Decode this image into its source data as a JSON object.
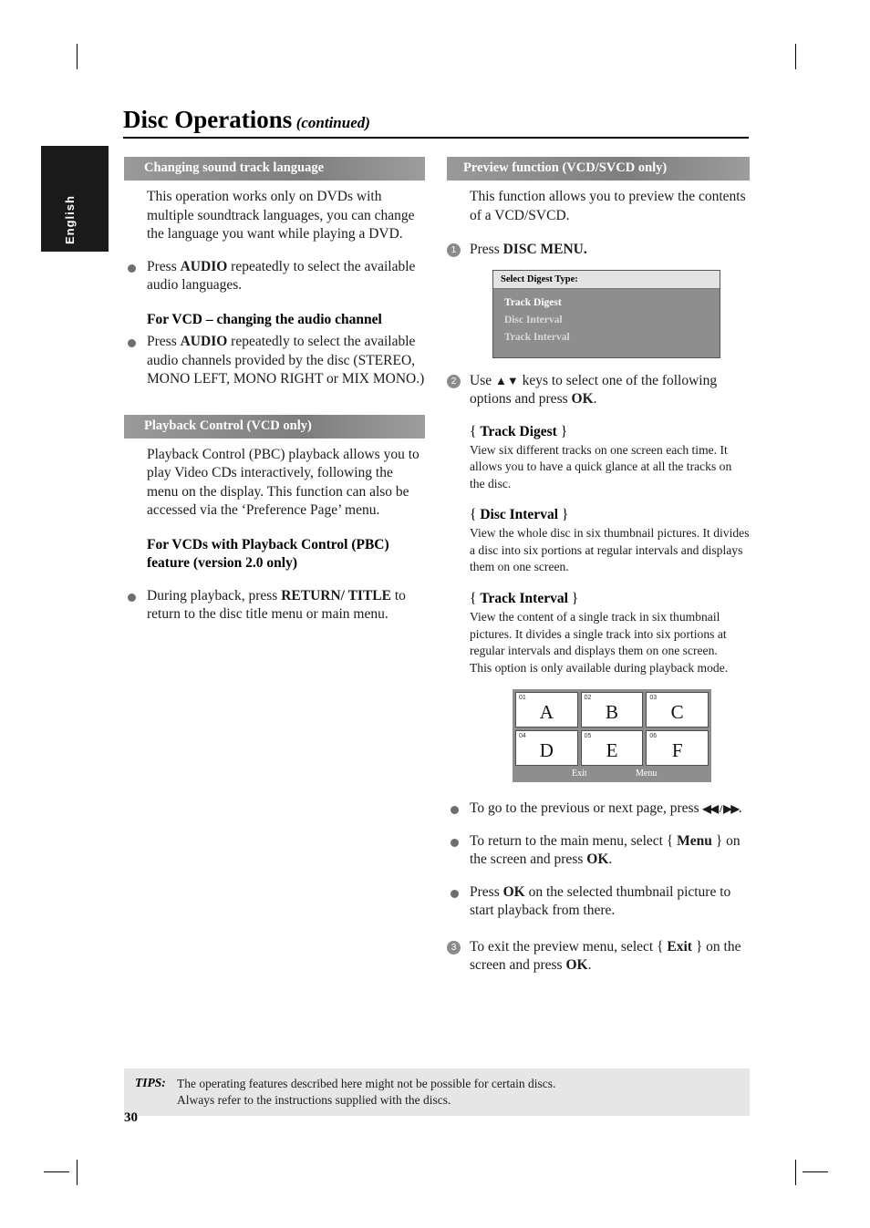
{
  "header": {
    "title": "Disc Operations",
    "title_suffix": "(continued)"
  },
  "side_tab": {
    "label": "English"
  },
  "left_column": {
    "section1": {
      "heading": "Changing sound track language",
      "intro": "This operation works only on DVDs with multiple soundtrack languages, you can change the language you want while playing a DVD.",
      "bullet1_pre": "Press ",
      "bullet1_bold": "AUDIO",
      "bullet1_post": " repeatedly to select the available audio languages.",
      "subhead": "For VCD – changing the audio channel",
      "bullet2_pre": "Press ",
      "bullet2_bold": "AUDIO",
      "bullet2_post": " repeatedly to select the available audio channels provided by the disc (STEREO, MONO LEFT, MONO RIGHT or MIX MONO.)"
    },
    "section2": {
      "heading": "Playback Control (VCD only)",
      "intro": "Playback Control (PBC) playback allows you to play Video CDs interactively, following the menu on the display.  This function can also be accessed via the ‘Preference Page’ menu.",
      "subhead": "For VCDs with Playback Control (PBC) feature (version 2.0 only)",
      "bullet1_pre": "During playback, press ",
      "bullet1_bold": "RETURN/ TITLE",
      "bullet1_post": " to return to the disc title menu or main menu."
    }
  },
  "right_column": {
    "section1": {
      "heading": "Preview function (VCD/SVCD only)",
      "intro": "This function allows you to preview the contents of a VCD/SVCD.",
      "step1_num": "1",
      "step1_pre": "Press ",
      "step1_bold": "DISC MENU.",
      "osd": {
        "title": "Select Digest Type:",
        "options": [
          "Track Digest",
          "Disc Interval",
          "Track Interval"
        ],
        "selected_index": 0
      },
      "step2_num": "2",
      "step2_pre": "Use ",
      "step2_keys": "▲▼",
      "step2_mid": " keys to select one of the following options and press ",
      "step2_bold": "OK",
      "step2_post": ".",
      "items": [
        {
          "name": "Track Digest",
          "text": "View six different tracks on one screen each time.  It allows you to have a quick glance at all the tracks on the disc."
        },
        {
          "name": "Disc Interval",
          "text": "View the whole disc in six thumbnail pictures.  It divides a disc into six portions at regular intervals and displays them on one screen."
        },
        {
          "name": "Track Interval",
          "text": "View the content of a single track in six thumbnail pictures.  It divides a single track into six portions at regular intervals and displays them on one screen.\nThis option is only available during playback mode."
        }
      ],
      "thumbnails": {
        "cells": [
          {
            "number": "01",
            "letter": "A"
          },
          {
            "number": "02",
            "letter": "B"
          },
          {
            "number": "03",
            "letter": "C"
          },
          {
            "number": "04",
            "letter": "D"
          },
          {
            "number": "05",
            "letter": "E"
          },
          {
            "number": "06",
            "letter": "F"
          }
        ],
        "exit_label": "Exit",
        "menu_label": "Menu"
      },
      "bullets": [
        {
          "pre": "To go to the previous or next page, press ",
          "icons": "◀◀ / ▶▶",
          "post": "."
        },
        {
          "pre": "To return to the main menu, select { ",
          "bold": "Menu",
          "mid": " } on the screen and press ",
          "bold2": "OK",
          "post": "."
        },
        {
          "pre": "Press ",
          "bold": "OK",
          "post": " on the selected thumbnail picture to start playback from there."
        }
      ],
      "step3_num": "3",
      "step3_pre": "To exit the preview menu, select { ",
      "step3_bold": "Exit",
      "step3_mid": " } on the screen and press ",
      "step3_bold2": "OK",
      "step3_post": "."
    }
  },
  "tips": {
    "label": "TIPS:",
    "line1": "The operating features described here might not be possible for certain discs.",
    "line2": "Always refer to the instructions supplied with the discs."
  },
  "page_number": "30"
}
